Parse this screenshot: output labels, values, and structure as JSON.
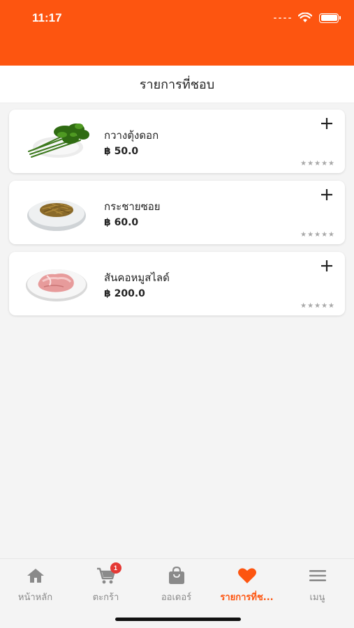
{
  "status_bar": {
    "time": "11:17"
  },
  "header": {
    "title": "รายการที่ชอบ"
  },
  "favorites": [
    {
      "name": "กวางตุ้งดอก",
      "price": "฿ 50.0",
      "rating_stars": "★★★★★",
      "image": "green-vegetable-image"
    },
    {
      "name": "กระชายซอย",
      "price": "฿ 60.0",
      "rating_stars": "★★★★★",
      "image": "shredded-root-image"
    },
    {
      "name": "สันคอหมูสไลด์",
      "price": "฿ 200.0",
      "rating_stars": "★★★★★",
      "image": "sliced-pork-image"
    }
  ],
  "tab_bar": {
    "tabs": [
      {
        "label": "หน้าหลัก",
        "icon": "home-icon"
      },
      {
        "label": "ตะกร้า",
        "icon": "cart-icon",
        "badge": "1"
      },
      {
        "label": "ออเดอร์",
        "icon": "bag-icon"
      },
      {
        "label": "รายการที่ช...",
        "icon": "heart-icon",
        "active": true
      },
      {
        "label": "เมนู",
        "icon": "menu-icon"
      }
    ]
  },
  "colors": {
    "accent": "#fd5510",
    "badge": "#e53935",
    "inactive": "#8a8a8a"
  }
}
